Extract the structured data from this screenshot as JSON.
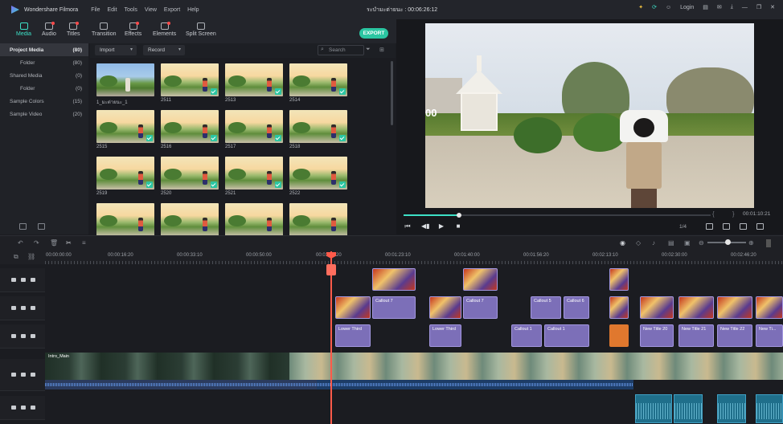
{
  "app": {
    "name": "Wondershare Filmora",
    "menu": [
      "File",
      "Edit",
      "Tools",
      "View",
      "Export",
      "Help"
    ],
    "project_title": "ระบำมะต่ายนะ : 00:06:26:12",
    "login": "Login"
  },
  "toolbar": {
    "tools": [
      {
        "label": "Media",
        "icon": "folder-icon"
      },
      {
        "label": "Audio",
        "icon": "music-note-icon"
      },
      {
        "label": "Titles",
        "icon": "text-icon"
      },
      {
        "label": "Transition",
        "icon": "transition-icon"
      },
      {
        "label": "Effects",
        "icon": "sparkle-icon"
      },
      {
        "label": "Elements",
        "icon": "elements-icon"
      },
      {
        "label": "Split Screen",
        "icon": "split-screen-icon"
      }
    ],
    "export_label": "EXPORT"
  },
  "library": {
    "items": [
      {
        "label": "Project Media",
        "count": "(80)"
      },
      {
        "label": "Folder",
        "count": "(80)"
      },
      {
        "label": "Shared Media",
        "count": "(0)"
      },
      {
        "label": "Folder",
        "count": "(0)"
      },
      {
        "label": "Sample Colors",
        "count": "(15)"
      },
      {
        "label": "Sample Video",
        "count": "(20)"
      }
    ]
  },
  "media": {
    "import_label": "Import",
    "record_label": "Record",
    "search_placeholder": "Search",
    "tiles": [
      {
        "label": "1_มะต่ายนะ_1"
      },
      {
        "label": "2511"
      },
      {
        "label": "2513"
      },
      {
        "label": "2514"
      },
      {
        "label": "2515"
      },
      {
        "label": "2516"
      },
      {
        "label": "2517"
      },
      {
        "label": "2518"
      },
      {
        "label": "2519"
      },
      {
        "label": "2520"
      },
      {
        "label": "2521"
      },
      {
        "label": "2522"
      },
      {
        "label": ""
      },
      {
        "label": ""
      },
      {
        "label": ""
      },
      {
        "label": ""
      }
    ]
  },
  "preview": {
    "overlay_text": "00",
    "timecode": "00:01:10:21",
    "brackets": "{ }",
    "ratio": "1/4",
    "progress_fraction": 0.18
  },
  "timeline": {
    "ruler": [
      "00:00:00:00",
      "00:00:16:20",
      "00:00:33:10",
      "00:00:50:00",
      "00:01:06:20",
      "00:01:23:10",
      "00:01:40:00",
      "00:01:56:20",
      "00:02:13:10",
      "00:02:30:00",
      "00:02:46:20"
    ],
    "clips": {
      "callout": "Callout 7",
      "callout5": "Callout 5",
      "callout6": "Callout 6",
      "callout1": "Callout 1",
      "lower_third": "Lower Third",
      "new_title": "New Title 20",
      "new_title21": "New Title 21",
      "new_title22": "New Title 22",
      "new_title23": "New Ti...",
      "intro": "Intro_Main"
    }
  },
  "colors": {
    "accent": "#3de0c6",
    "export": "#2bc6a2",
    "playhead": "#ff5a4a",
    "title_clip": "#7c6fb8"
  }
}
